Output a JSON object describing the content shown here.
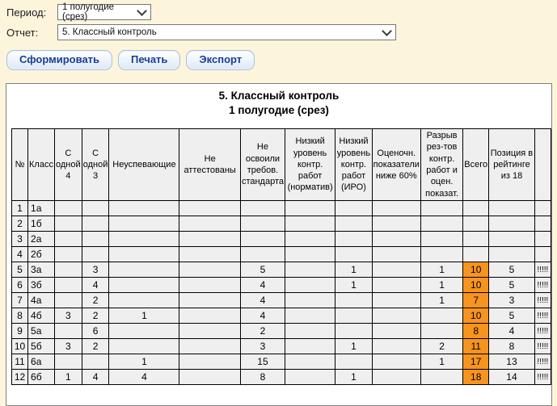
{
  "controls": {
    "period_label": "Период:",
    "period_value": "1 полугодие (срез)",
    "report_label": "Отчет:",
    "report_value": "5. Классный контроль",
    "buttons": {
      "generate": "Сформировать",
      "print": "Печать",
      "export": "Экспорт"
    }
  },
  "report": {
    "title_line1": "5. Классный контроль",
    "title_line2": "1 полугодие (срез)",
    "table": {
      "columns": [
        "№",
        "Класс",
        "С одной 4",
        "С одной 3",
        "Неуспевающие",
        "Не аттестованы",
        "Не освоили требов. стандарта",
        "Низкий уровень контр. работ (норматив)",
        "Низкий уровень контр. работ (ИРО)",
        "Оценочн. показатели ниже 60%",
        "Разрыв рез-тов контр. работ и оцен. показат.",
        "Всего",
        "Позиция в рейтинге из 18",
        ""
      ],
      "rows": [
        [
          "1",
          "1а",
          "",
          "",
          "",
          "",
          "",
          "",
          "",
          "",
          "",
          "",
          "",
          ""
        ],
        [
          "2",
          "1б",
          "",
          "",
          "",
          "",
          "",
          "",
          "",
          "",
          "",
          "",
          "",
          ""
        ],
        [
          "3",
          "2а",
          "",
          "",
          "",
          "",
          "",
          "",
          "",
          "",
          "",
          "",
          "",
          ""
        ],
        [
          "4",
          "2б",
          "",
          "",
          "",
          "",
          "",
          "",
          "",
          "",
          "",
          "",
          "",
          ""
        ],
        [
          "5",
          "3а",
          "",
          "3",
          "",
          "",
          "5",
          "",
          "1",
          "",
          "1",
          "10",
          "5",
          "!!!!!"
        ],
        [
          "6",
          "3б",
          "",
          "4",
          "",
          "",
          "4",
          "",
          "1",
          "",
          "1",
          "10",
          "5",
          "!!!!!"
        ],
        [
          "7",
          "4а",
          "",
          "2",
          "",
          "",
          "4",
          "",
          "",
          "",
          "1",
          "7",
          "3",
          "!!!!!"
        ],
        [
          "8",
          "4б",
          "3",
          "2",
          "1",
          "",
          "4",
          "",
          "",
          "",
          "",
          "10",
          "5",
          "!!!!!"
        ],
        [
          "9",
          "5а",
          "",
          "6",
          "",
          "",
          "2",
          "",
          "",
          "",
          "",
          "8",
          "4",
          "!!!!!"
        ],
        [
          "10",
          "5б",
          "3",
          "2",
          "",
          "",
          "3",
          "",
          "1",
          "",
          "2",
          "11",
          "8",
          "!!!!!"
        ],
        [
          "11",
          "6а",
          "",
          "",
          "1",
          "",
          "15",
          "",
          "",
          "",
          "1",
          "17",
          "13",
          "!!!!!"
        ],
        [
          "12",
          "6б",
          "1",
          "4",
          "4",
          "",
          "8",
          "",
          "1",
          "",
          "",
          "18",
          "14",
          "!!!!!"
        ]
      ]
    }
  },
  "colors": {
    "total_highlight": "#F7941D",
    "page_background": "#FCF5DC",
    "cell_background": "#EFEFEF",
    "button_text": "#1A3E94"
  }
}
